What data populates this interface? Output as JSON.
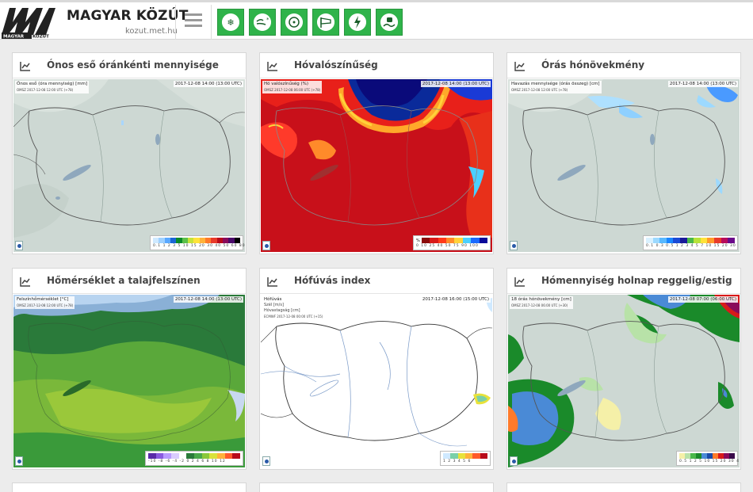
{
  "header": {
    "brand": "MAGYAR KÖZÚT",
    "url": "kozut.met.hu",
    "logo_text": "MAGYAR KÖZÚT",
    "menu_icon": "hamburger-menu-icon",
    "buttons": [
      {
        "name": "snow-layer-button",
        "icon": "snowflake-icon"
      },
      {
        "name": "snow-drift-button",
        "icon": "wind-snow-icon"
      },
      {
        "name": "frost-layer-button",
        "icon": "frost-icon"
      },
      {
        "name": "wind-layer-button",
        "icon": "windsock-icon"
      },
      {
        "name": "lightning-layer-button",
        "icon": "lightning-icon"
      },
      {
        "name": "slippery-road-button",
        "icon": "skid-car-icon"
      }
    ],
    "accent_color": "#2fb34a"
  },
  "panels": [
    {
      "title": "Ónos eső óránkénti mennyisége",
      "map_label": "Ónos eső (óra mennyiség) [mm]",
      "map_sub": "OMSZ 2017-12-08 12:00 UTC (+78)",
      "time": "2017-12-08 14:00 (13:00 UTC)",
      "legend_ticks": "0.1 1 2 3 5 10 15 20 30 40 50 60 80 100 200",
      "legend_colors": [
        "#cfe9ff",
        "#9ed0ff",
        "#5aa8ff",
        "#1b66d6",
        "#0b8a2a",
        "#5cc04a",
        "#c6e23a",
        "#ffe23a",
        "#ffb23a",
        "#ff7a2a",
        "#e83a2a",
        "#b80a1a",
        "#8a0a5a",
        "#4a0a6a",
        "#000000"
      ]
    },
    {
      "title": "Hóvalószínűség",
      "map_label": "Hó valószínűség (%)",
      "map_sub": "OMSZ 2017-12-08 06:00 UTC (+78)",
      "time": "2017-12-08 14:00 (13:00 UTC)",
      "legend_ticks": "0 10 25 40 50 75 90 100",
      "legend_unit": "%",
      "legend_colors": [
        "#8a0a0a",
        "#d81a1a",
        "#ff3a1a",
        "#ff8a2a",
        "#ffd23a",
        "#4ad0ff",
        "#1a6aff",
        "#0a0a9a"
      ]
    },
    {
      "title": "Órás hónövekmény",
      "map_label": "Havazás mennyisége (órás összeg) [cm]",
      "map_sub": "OMSZ 2017-12-08 12:00 UTC (+78)",
      "time": "2017-12-08 14:00 (13:00 UTC)",
      "legend_ticks": "0.1 0.3 0.5 1 2 3 4 5 7 10 15 20 30",
      "legend_colors": [
        "#d9f1ff",
        "#9cd9ff",
        "#58b8ff",
        "#1a86ff",
        "#1a4ad6",
        "#1a1a9a",
        "#4ab84a",
        "#b8e23a",
        "#ffe23a",
        "#ff9a2a",
        "#e83a2a",
        "#b80a5a",
        "#6a0a8a"
      ]
    },
    {
      "title": "Hőmérséklet a talajfelszínen",
      "map_label": "Felszínhőmérséklet [°C]",
      "map_sub": "OMSZ 2017-12-08 12:00 UTC (+78)",
      "time": "2017-12-08 14:00 (13:00 UTC)",
      "legend_ticks": "-10 -8 -6 -4 -2 0 2 4 6 8 10 12",
      "legend_colors": [
        "#5a2aa8",
        "#8a5ae0",
        "#b89aff",
        "#d9ccff",
        "#ffffff",
        "#2a7a3a",
        "#4aa84a",
        "#8ac83a",
        "#d9e23a",
        "#ffb23a",
        "#ff5a2a",
        "#b80a1a"
      ]
    },
    {
      "title": "Hófúvás index",
      "map_label": "Hófúvás",
      "map_lines": [
        "Szél [m/s]",
        "Hóvastagság [cm]",
        "ECMWF 2017-12-08 00:00 UTC (+15)"
      ],
      "time": "2017-12-08 16:00 (15:00 UTC)",
      "legend_ticks": "1 2 3 4 5 6",
      "legend_colors": [
        "#cfe9ff",
        "#7ad0a8",
        "#e8e23a",
        "#ffb23a",
        "#ff5a2a",
        "#b80a1a"
      ]
    },
    {
      "title": "Hómennyiség holnap reggelig/estig",
      "map_label": "18 órás hónövekmény [cm]",
      "map_sub": "OMSZ 2017-12-08 06:00 UTC (+30)",
      "time": "2017-12-08 07:00 (06:00 UTC)",
      "legend_ticks": "0.5 1 2 5 10 15 20 30 40 50",
      "legend_colors": [
        "#f5f0a8",
        "#b8e2a8",
        "#4ab84a",
        "#1a8a2a",
        "#4a8ad6",
        "#1a4aa8",
        "#ff7a2a",
        "#d81a1a",
        "#8a0a5a",
        "#3a0a4a"
      ]
    }
  ]
}
